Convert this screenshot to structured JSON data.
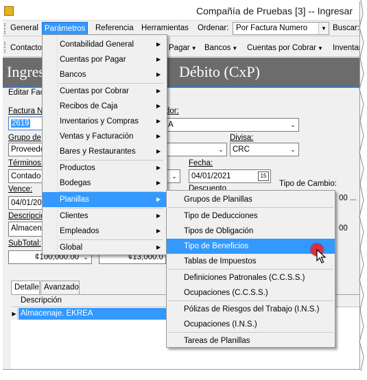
{
  "window": {
    "title": "Compañía de Pruebas [3] -- Ingresar"
  },
  "menubar": {
    "items": [
      "General",
      "Parámetros",
      "Referencia",
      "Herramientas",
      "Ordenar:",
      "Buscar:"
    ],
    "ordenar_value": "Por Factura Numero"
  },
  "toolbar": {
    "items": [
      "Contactos",
      "Pagar",
      "Bancos",
      "Cuentas por Cobrar",
      "Inventar"
    ]
  },
  "header": {
    "title_left": "Ingres",
    "title_right": "Débito (CxP)"
  },
  "edit_tab": "Editar Factu",
  "form": {
    "factura_label": "Factura N",
    "factura_value": "2619",
    "proveedor_label": "dor:",
    "proveedor_value": "A",
    "grupo_label": "Grupo de",
    "grupo_value": "Proveedo",
    "divisa_label": "Divisa:",
    "divisa_value": "CRC",
    "terminos_label": "Términos:",
    "terminos_value": "Contado",
    "fecha_label": "Fecha:",
    "fecha_value": "04/01/2021",
    "descuento_label": "Descuento",
    "tipo_cambio_label": "Tipo de Cambio:",
    "tipo_cambio_value": "00 ...",
    "vence_label": "Vence:",
    "vence_value": "04/01/20",
    "descripcion_label": "Descripció",
    "descripcion_value": "Almacena",
    "right_value": "00",
    "subtotal_label": "SubTotal:",
    "subtotal_value": "¢100,000.00",
    "tax_value": "¢13,000.0"
  },
  "tabs": [
    "Detalle",
    "Avanzado"
  ],
  "grid": {
    "column": "Descripción",
    "row_value": "Almacenaje. EKREA"
  },
  "params_menu": {
    "items": [
      {
        "label": "Contabilidad General",
        "submenu": true
      },
      {
        "label": "Cuentas por Pagar",
        "submenu": true
      },
      {
        "label": "Bancos",
        "submenu": true
      },
      {
        "label": "Cuentas por Cobrar",
        "submenu": true
      },
      {
        "label": "Recibos de Caja",
        "submenu": true
      },
      {
        "label": "Inventarios y Compras",
        "submenu": true
      },
      {
        "label": "Ventas y Facturación",
        "submenu": true
      },
      {
        "label": "Bares y Restaurantes",
        "submenu": true
      },
      {
        "label": "Productos",
        "submenu": true
      },
      {
        "label": "Bodegas",
        "submenu": true
      },
      {
        "label": "Planillas",
        "submenu": true
      },
      {
        "label": "Clientes",
        "submenu": true
      },
      {
        "label": "Empleados",
        "submenu": true
      },
      {
        "label": "Global",
        "submenu": true
      }
    ],
    "highlighted": "Planillas"
  },
  "planillas_menu": {
    "items": [
      "Grupos de Planillas",
      "Tipo de Deducciones",
      "Tipos de Obligación",
      "Tipo de Beneficios",
      "Tablas de Impuestos",
      "Definiciones Patronales (C.C.S.S.)",
      "Ocupaciones (C.C.S.S.)",
      "Pólizas de Riesgos del Trabajo (I.N.S.)",
      "Ocupaciones (I.N.S.)",
      "Tareas de Planillas"
    ],
    "highlighted": "Tipo de Beneficios"
  },
  "colors": {
    "accent": "#3399ff",
    "header": "#6c6c6c",
    "cursor_dot": "#d83040"
  },
  "icons": [
    "app-icon",
    "chevron-right-icon",
    "dropdown-arrow-icon",
    "calendar-icon",
    "row-indicator-icon",
    "mouse-pointer-icon"
  ]
}
